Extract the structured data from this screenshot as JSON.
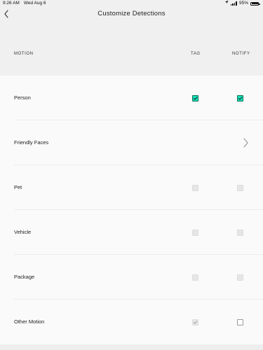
{
  "status_bar": {
    "time": "9:26 AM",
    "date": "Wed Aug 6",
    "battery": "95%"
  },
  "header": {
    "title": "Customize Detections",
    "back_icon": "chevron-left-icon"
  },
  "columns": {
    "section": "MOTION",
    "tag": "TAG",
    "notify": "NOTIFY"
  },
  "rows": [
    {
      "label": "Person",
      "tag": "checked",
      "notify": "checked"
    },
    {
      "label": "Friendly Faces",
      "action": "chevron-right-icon"
    },
    {
      "label": "Pet",
      "tag": "disabled",
      "notify": "disabled"
    },
    {
      "label": "Vehicle",
      "tag": "disabled",
      "notify": "disabled"
    },
    {
      "label": "Package",
      "tag": "disabled",
      "notify": "disabled"
    },
    {
      "label": "Other Motion",
      "tag": "checked-disabled",
      "notify": "unchecked"
    }
  ],
  "colors": {
    "accent": "#19e3b8",
    "header_bg": "#f0f0f0",
    "list_bg": "#fafafa"
  }
}
